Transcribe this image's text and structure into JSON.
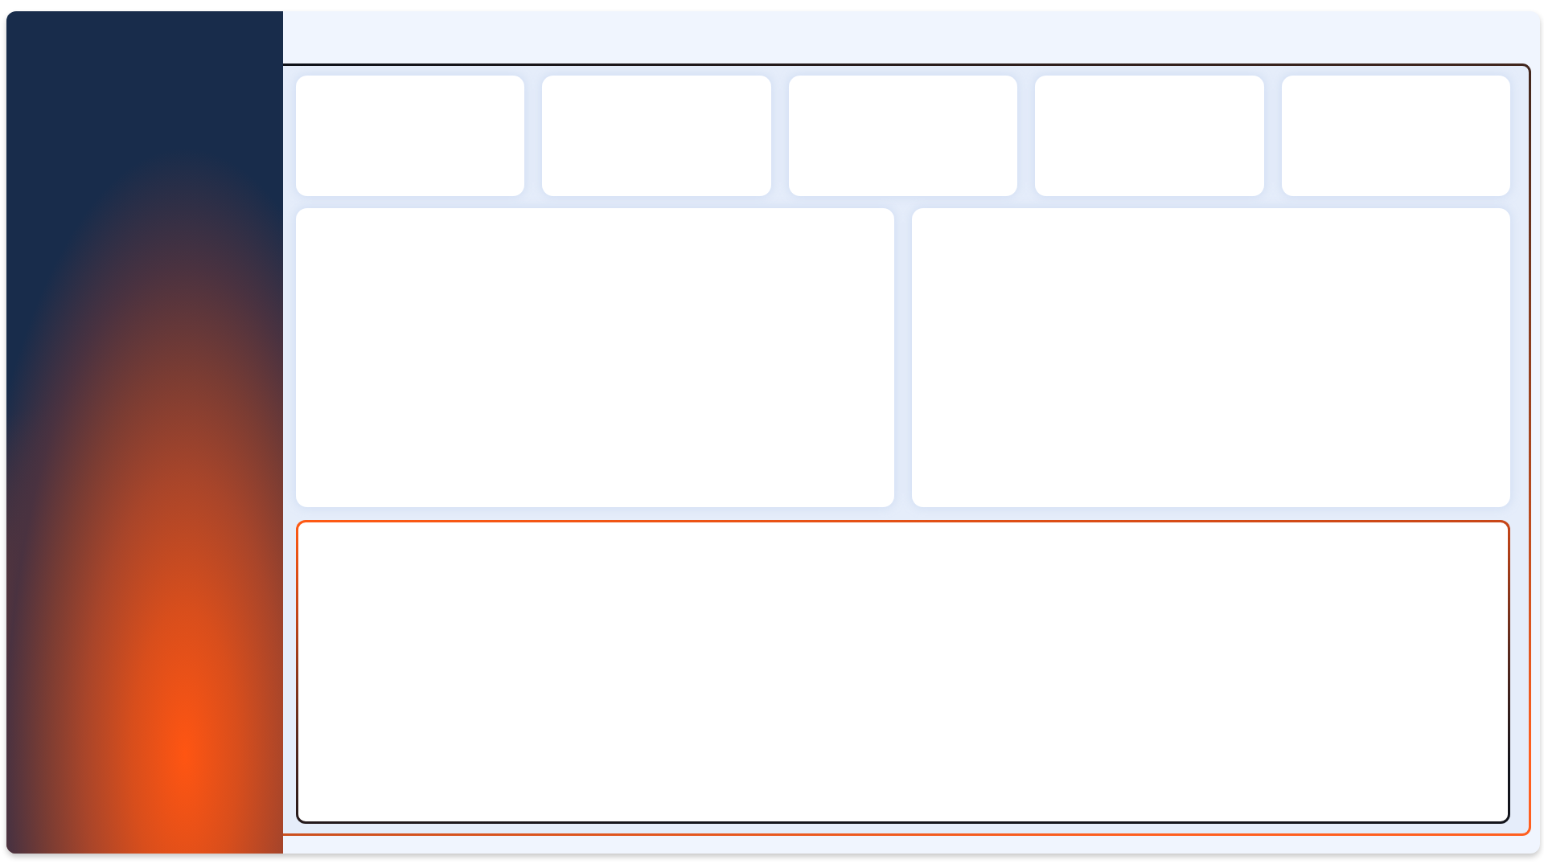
{
  "stat_cards": [
    {
      "highlighted": false
    },
    {
      "highlighted": false
    },
    {
      "highlighted": false
    },
    {
      "highlighted": false
    },
    {
      "highlighted": false
    }
  ],
  "panels": [
    {
      "highlighted": false
    },
    {
      "highlighted": false
    },
    {
      "highlighted": true
    }
  ]
}
